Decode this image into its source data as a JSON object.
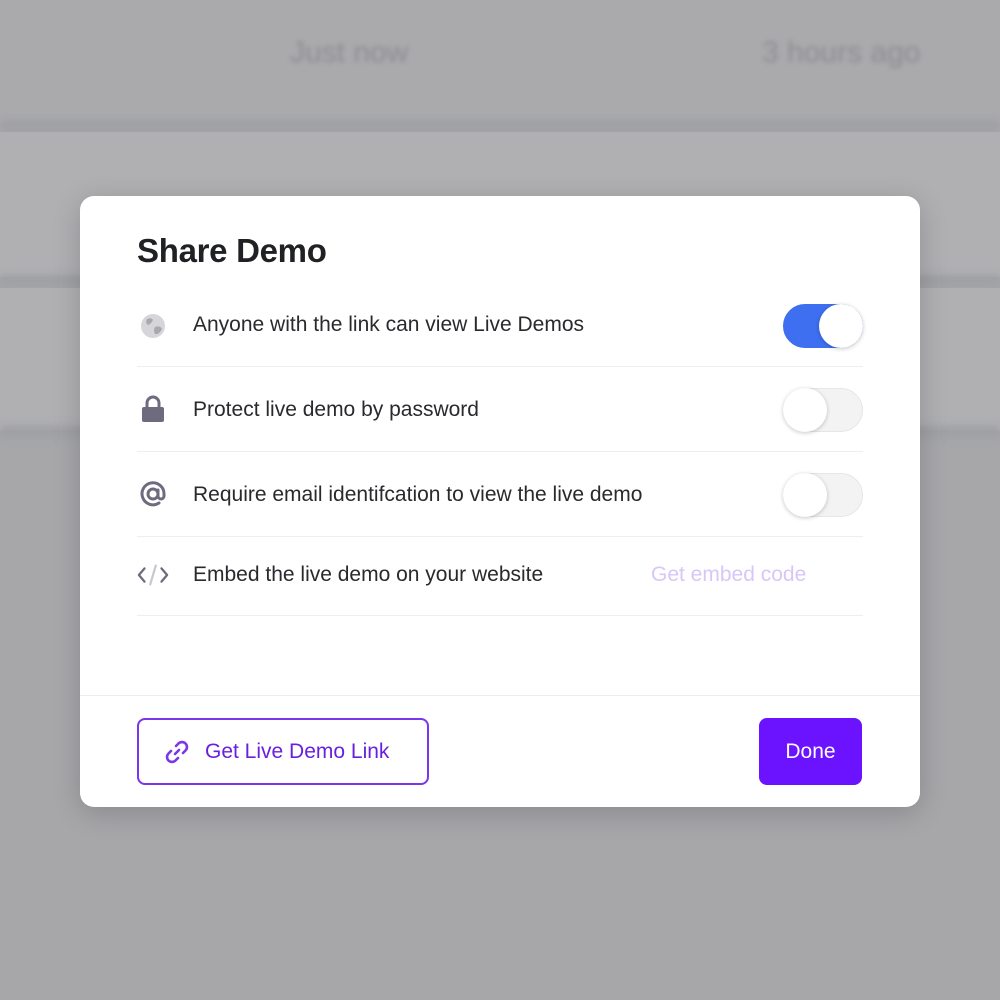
{
  "background": {
    "top_left_text": "Just now",
    "top_right_text": "3 hours ago"
  },
  "modal": {
    "title": "Share Demo",
    "options": [
      {
        "icon": "globe-icon",
        "label": "Anyone with the link can view Live Demos",
        "toggle": true
      },
      {
        "icon": "lock-icon",
        "label": "Protect live demo by password",
        "toggle": false
      },
      {
        "icon": "at-sign-icon",
        "label": "Require email identifcation to view the live demo",
        "toggle": false
      }
    ],
    "embed": {
      "icon": "code-icon",
      "label": "Embed the live demo on your website",
      "action": "Get embed code"
    },
    "footer": {
      "link_button": "Get Live Demo Link",
      "link_icon": "link-icon",
      "done_button": "Done"
    }
  },
  "colors": {
    "accent_purple": "#6b12ff",
    "toggle_on_blue": "#3d6ff0",
    "embed_link_color": "#d8c6f7"
  }
}
